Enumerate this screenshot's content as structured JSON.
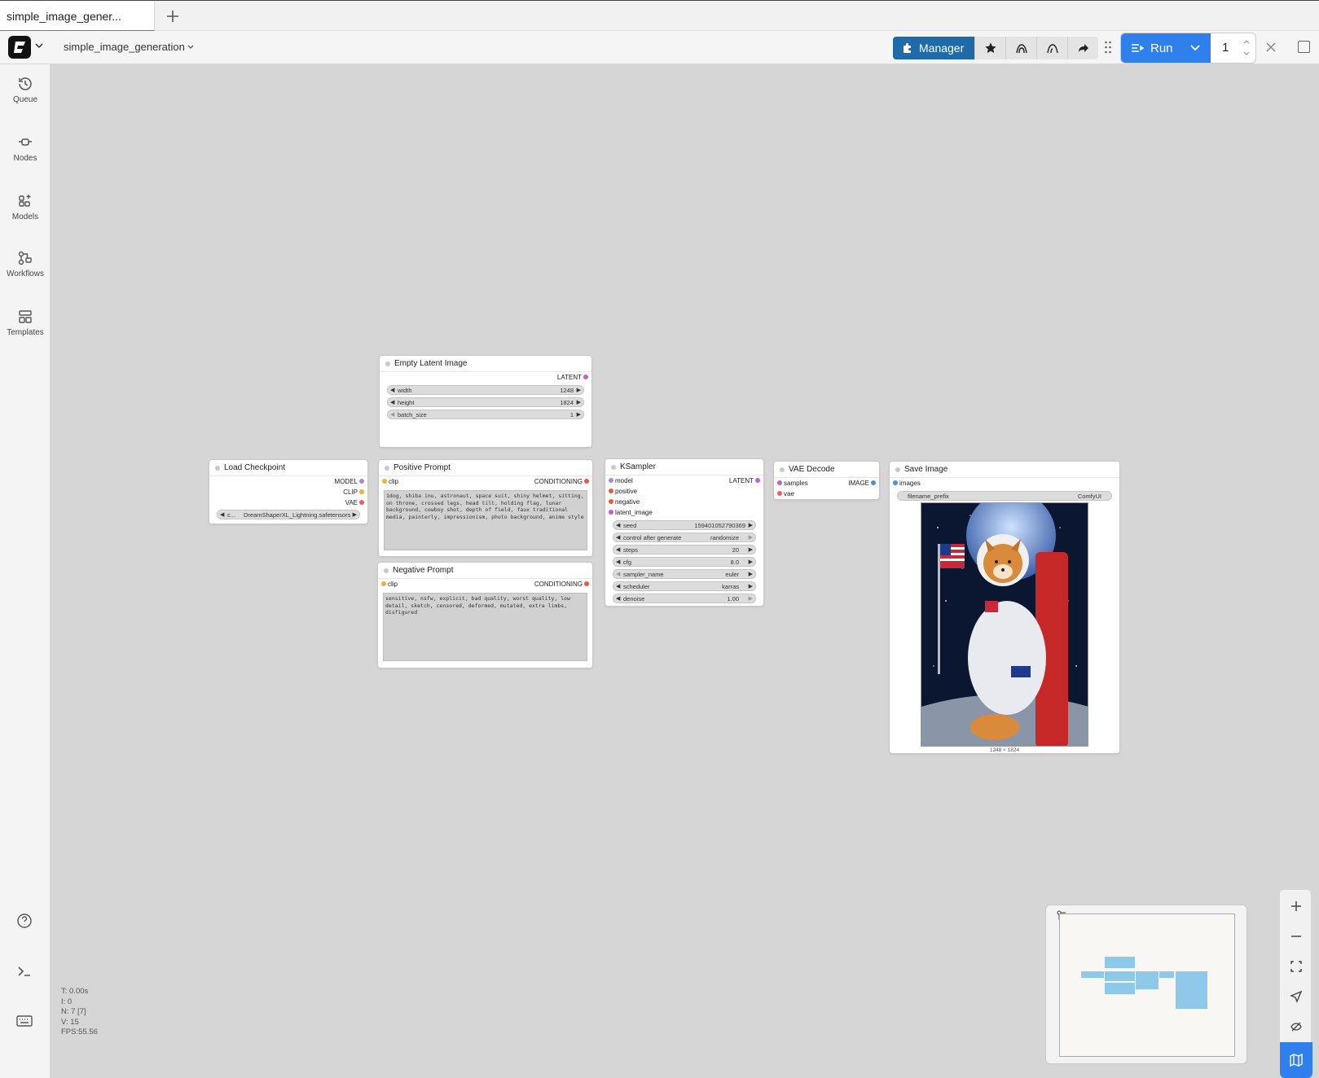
{
  "tabs": [
    {
      "label": "simple_image_gener..."
    }
  ],
  "toolbar": {
    "workflow_name": "simple_image_generation",
    "manager_label": "Manager",
    "run_label": "Run",
    "run_count": "1"
  },
  "sidebar": {
    "items": [
      {
        "label": "Queue",
        "icon": "history-icon"
      },
      {
        "label": "Nodes",
        "icon": "nodes-icon"
      },
      {
        "label": "Models",
        "icon": "models-icon"
      },
      {
        "label": "Workflows",
        "icon": "workflows-icon"
      },
      {
        "label": "Templates",
        "icon": "templates-icon"
      }
    ]
  },
  "nodes": {
    "empty_latent": {
      "title": "Empty Latent Image",
      "output": "LATENT",
      "widgets": [
        {
          "label": "width",
          "value": "1248"
        },
        {
          "label": "height",
          "value": "1824"
        },
        {
          "label": "batch_size",
          "value": "1"
        }
      ]
    },
    "load_checkpoint": {
      "title": "Load Checkpoint",
      "outputs": [
        "MODEL",
        "CLIP",
        "VAE"
      ],
      "ckpt_prefix": "c...",
      "ckpt_value": "DreamShaperXL_Lightning.safetensors"
    },
    "positive": {
      "title": "Positive Prompt",
      "input": "clip",
      "output": "CONDITIONING",
      "text": "1dog, shiba inu, astronaut, space suit, shiny helmet, sitting, on throne, crossed legs, head tilt, holding flag, lunar background, cowboy shot, depth of field, faux traditional media, painterly, impressionism, photo background, anime style"
    },
    "negative": {
      "title": "Negative Prompt",
      "input": "clip",
      "output": "CONDITIONING",
      "text": "sensitive, nsfw, explicit, bad quality, worst quality, low detail, sketch, censored, deformed, mutated, extra limbs, disfigured"
    },
    "ksampler": {
      "title": "KSampler",
      "inputs": [
        "model",
        "positive",
        "negative",
        "latent_image"
      ],
      "output": "LATENT",
      "widgets": [
        {
          "label": "seed",
          "value": "159401052790369"
        },
        {
          "label": "control after generate",
          "value": "randomize"
        },
        {
          "label": "steps",
          "value": "20"
        },
        {
          "label": "cfg",
          "value": "8.0"
        },
        {
          "label": "sampler_name",
          "value": "euler"
        },
        {
          "label": "scheduler",
          "value": "karras"
        },
        {
          "label": "denoise",
          "value": "1.00"
        }
      ]
    },
    "vae_decode": {
      "title": "VAE Decode",
      "inputs": [
        "samples",
        "vae"
      ],
      "output": "IMAGE"
    },
    "save_image": {
      "title": "Save Image",
      "input": "images",
      "filename_label": "filename_prefix",
      "filename_value": "ComfyUI",
      "caption": "1248 × 1824"
    }
  },
  "stats": {
    "t": "T: 0.00s",
    "i": "I: 0",
    "n": "N: 7 [7]",
    "v": "V: 15",
    "fps": "FPS:55.56"
  },
  "colors": {
    "accent": "#2f80ed",
    "manager": "#1f6aa8",
    "model_slot": "#b39ddb",
    "clip_slot": "#f5b84a",
    "vae_slot": "#ff6e6e",
    "latent_slot": "#ff9cf9",
    "conditioning_slot": "#ffa931",
    "image_slot": "#64b5f6"
  }
}
